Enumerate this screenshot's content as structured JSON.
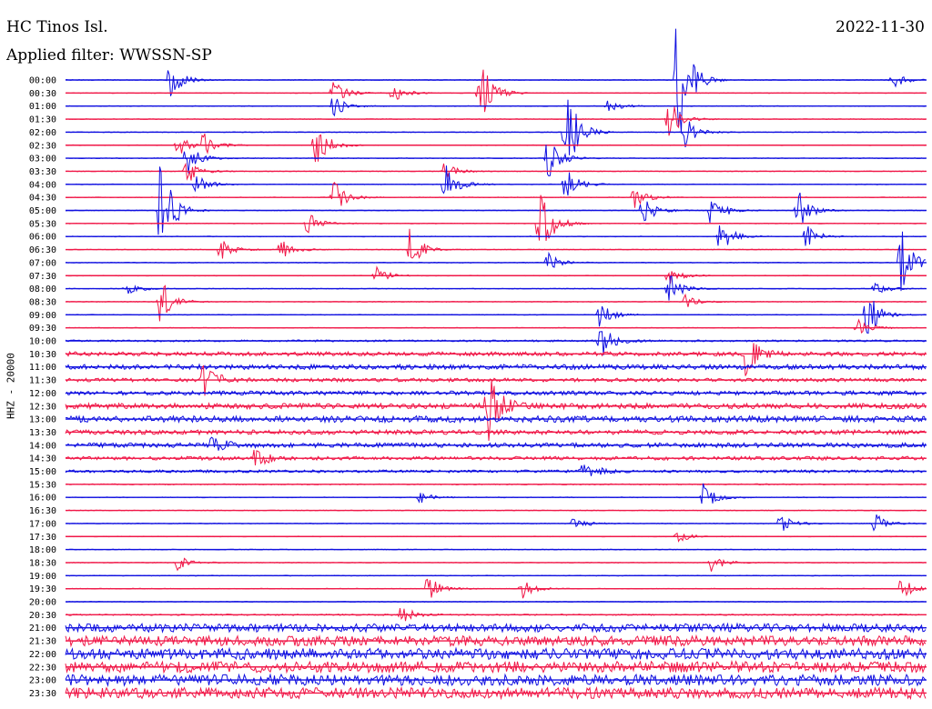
{
  "header": {
    "station": "HC Tinos Isl.",
    "filter": "Applied filter: WWSSN-SP",
    "date": "2022-11-30"
  },
  "axis": {
    "channel_label": "HHZ - 20000"
  },
  "colors": {
    "blue": "#1010e0",
    "red": "#f01848",
    "axis_text": "#000000"
  },
  "chart_data": {
    "type": "line",
    "title": "HC Tinos Isl.",
    "subtitle": "Applied filter: WWSSN-SP",
    "ylabel": "HHZ - 20000",
    "row_labels": [
      "00:00",
      "00:30",
      "01:00",
      "01:30",
      "02:00",
      "02:30",
      "03:00",
      "03:30",
      "04:00",
      "04:30",
      "05:00",
      "05:30",
      "06:00",
      "06:30",
      "07:00",
      "07:30",
      "08:00",
      "08:30",
      "09:00",
      "09:30",
      "10:00",
      "10:30",
      "11:00",
      "11:30",
      "12:00",
      "12:30",
      "13:00",
      "13:30",
      "14:00",
      "14:30",
      "15:00",
      "15:30",
      "16:00",
      "16:30",
      "17:00",
      "17:30",
      "18:00",
      "18:30",
      "19:00",
      "19:30",
      "20:00",
      "20:30",
      "21:00",
      "21:30",
      "22:00",
      "22:30",
      "23:00",
      "23:30"
    ],
    "row_colors": "alternating blue / red",
    "noise_level": [
      0.08,
      0.08,
      0.08,
      0.08,
      0.08,
      0.08,
      0.08,
      0.08,
      0.08,
      0.08,
      0.08,
      0.08,
      0.08,
      0.08,
      0.08,
      0.08,
      0.08,
      0.08,
      0.08,
      0.08,
      0.2,
      0.45,
      0.55,
      0.4,
      0.45,
      0.6,
      0.7,
      0.5,
      0.5,
      0.4,
      0.3,
      0.12,
      0.08,
      0.08,
      0.08,
      0.08,
      0.08,
      0.08,
      0.08,
      0.08,
      0.08,
      0.15,
      0.9,
      1.1,
      1.2,
      1.2,
      1.2,
      1.2
    ],
    "events": [
      {
        "row": 0,
        "t": 0.12,
        "amp": 2.0
      },
      {
        "row": 0,
        "t": 0.71,
        "amp": 6.5
      },
      {
        "row": 0,
        "t": 0.96,
        "amp": 0.8
      },
      {
        "row": 1,
        "t": 0.48,
        "amp": 3.2
      },
      {
        "row": 1,
        "t": 0.31,
        "amp": 1.2
      },
      {
        "row": 1,
        "t": 0.38,
        "amp": 0.8
      },
      {
        "row": 2,
        "t": 0.31,
        "amp": 1.0
      },
      {
        "row": 2,
        "t": 0.63,
        "amp": 0.6
      },
      {
        "row": 3,
        "t": 0.7,
        "amp": 1.8
      },
      {
        "row": 4,
        "t": 0.58,
        "amp": 4.5
      },
      {
        "row": 4,
        "t": 0.72,
        "amp": 1.2
      },
      {
        "row": 5,
        "t": 0.29,
        "amp": 2.2
      },
      {
        "row": 5,
        "t": 0.13,
        "amp": 1.0
      },
      {
        "row": 5,
        "t": 0.16,
        "amp": 1.0
      },
      {
        "row": 6,
        "t": 0.14,
        "amp": 1.5
      },
      {
        "row": 6,
        "t": 0.56,
        "amp": 2.0
      },
      {
        "row": 7,
        "t": 0.14,
        "amp": 1.2
      },
      {
        "row": 7,
        "t": 0.44,
        "amp": 0.8
      },
      {
        "row": 8,
        "t": 0.44,
        "amp": 1.8
      },
      {
        "row": 8,
        "t": 0.58,
        "amp": 1.6
      },
      {
        "row": 8,
        "t": 0.15,
        "amp": 1.0
      },
      {
        "row": 9,
        "t": 0.31,
        "amp": 1.6
      },
      {
        "row": 9,
        "t": 0.66,
        "amp": 1.0
      },
      {
        "row": 10,
        "t": 0.11,
        "amp": 4.5
      },
      {
        "row": 10,
        "t": 0.67,
        "amp": 1.4
      },
      {
        "row": 10,
        "t": 0.75,
        "amp": 1.6
      },
      {
        "row": 10,
        "t": 0.85,
        "amp": 1.8
      },
      {
        "row": 11,
        "t": 0.55,
        "amp": 3.5
      },
      {
        "row": 11,
        "t": 0.28,
        "amp": 1.0
      },
      {
        "row": 12,
        "t": 0.76,
        "amp": 1.5
      },
      {
        "row": 12,
        "t": 0.86,
        "amp": 1.0
      },
      {
        "row": 13,
        "t": 0.18,
        "amp": 1.0
      },
      {
        "row": 13,
        "t": 0.4,
        "amp": 1.8
      },
      {
        "row": 13,
        "t": 0.25,
        "amp": 1.0
      },
      {
        "row": 14,
        "t": 0.56,
        "amp": 0.8
      },
      {
        "row": 14,
        "t": 0.97,
        "amp": 3.0
      },
      {
        "row": 15,
        "t": 0.7,
        "amp": 0.8
      },
      {
        "row": 15,
        "t": 0.36,
        "amp": 0.8
      },
      {
        "row": 16,
        "t": 0.07,
        "amp": 0.6
      },
      {
        "row": 16,
        "t": 0.7,
        "amp": 1.4
      },
      {
        "row": 16,
        "t": 0.94,
        "amp": 0.6
      },
      {
        "row": 17,
        "t": 0.11,
        "amp": 2.0
      },
      {
        "row": 17,
        "t": 0.72,
        "amp": 0.6
      },
      {
        "row": 18,
        "t": 0.62,
        "amp": 1.2
      },
      {
        "row": 18,
        "t": 0.93,
        "amp": 2.2
      },
      {
        "row": 19,
        "t": 0.92,
        "amp": 1.0
      },
      {
        "row": 20,
        "t": 0.62,
        "amp": 1.6
      },
      {
        "row": 21,
        "t": 0.79,
        "amp": 1.8
      },
      {
        "row": 23,
        "t": 0.16,
        "amp": 1.5
      },
      {
        "row": 25,
        "t": 0.49,
        "amp": 3.5
      },
      {
        "row": 28,
        "t": 0.17,
        "amp": 1.0
      },
      {
        "row": 29,
        "t": 0.22,
        "amp": 0.8
      },
      {
        "row": 30,
        "t": 0.6,
        "amp": 1.2
      },
      {
        "row": 32,
        "t": 0.41,
        "amp": 0.6
      },
      {
        "row": 32,
        "t": 0.74,
        "amp": 1.2
      },
      {
        "row": 34,
        "t": 0.59,
        "amp": 0.6
      },
      {
        "row": 34,
        "t": 0.83,
        "amp": 0.8
      },
      {
        "row": 34,
        "t": 0.94,
        "amp": 0.8
      },
      {
        "row": 35,
        "t": 0.71,
        "amp": 0.6
      },
      {
        "row": 37,
        "t": 0.13,
        "amp": 0.6
      },
      {
        "row": 37,
        "t": 0.75,
        "amp": 0.8
      },
      {
        "row": 39,
        "t": 0.42,
        "amp": 1.2
      },
      {
        "row": 39,
        "t": 0.53,
        "amp": 0.8
      },
      {
        "row": 39,
        "t": 0.97,
        "amp": 1.0
      },
      {
        "row": 41,
        "t": 0.39,
        "amp": 0.8
      }
    ]
  }
}
